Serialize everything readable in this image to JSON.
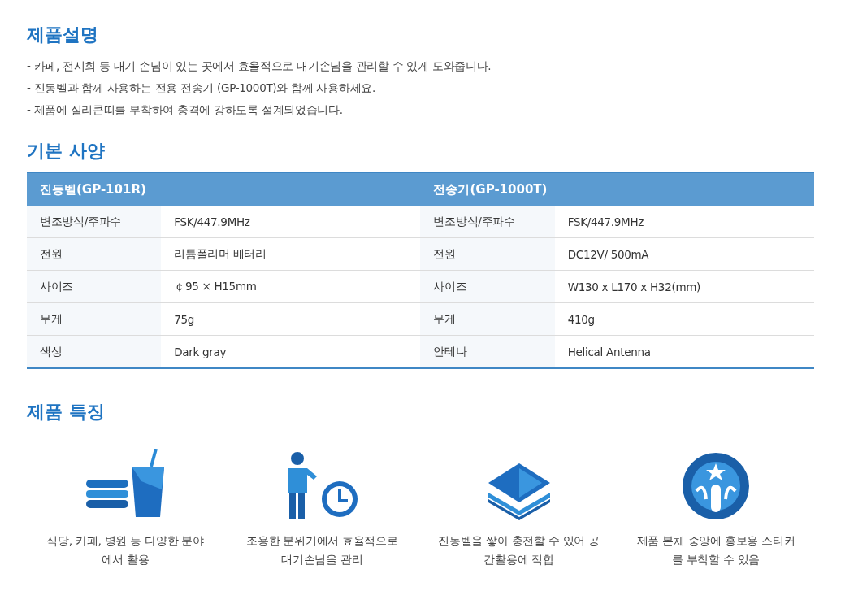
{
  "description": {
    "title": "제품설명",
    "lines": [
      "- 카페, 전시회 등 대기 손님이 있는 곳에서 효율적으로 대기손님을 관리할 수 있게 도와줍니다.",
      "- 진동벨과 함께 사용하는 전용 전송기 (GP-1000T)와 함께 사용하세요.",
      "- 제품에 실리콘띠를 부착하여 충격에 강하도록 설계되었습니다."
    ]
  },
  "specs": {
    "title": "기본 사양",
    "headers": [
      "진동벨(GP-101R)",
      "전송기(GP-1000T)"
    ],
    "rows": [
      [
        "변조방식/주파수",
        "FSK/447.9MHz",
        "변조방식/주파수",
        "FSK/447.9MHz"
      ],
      [
        "전원",
        "리튬폴리머 배터리",
        "전원",
        "DC12V/ 500mA"
      ],
      [
        "사이즈",
        "￠95 × H15mm",
        "사이즈",
        "W130 x L170 x H32(mm)"
      ],
      [
        "무게",
        "75g",
        "무게",
        "410g"
      ],
      [
        "색상",
        "Dark gray",
        "안테나",
        "Helical Antenna"
      ]
    ]
  },
  "features": {
    "title": "제품 특징",
    "items": [
      {
        "kind": "food",
        "lines": [
          "식당, 카페, 병원 등 다양한 분야",
          "에서 활용"
        ]
      },
      {
        "kind": "person",
        "lines": [
          "조용한 분위기에서 효율적으로",
          "대기손님을 관리"
        ]
      },
      {
        "kind": "stack",
        "lines": [
          "진동벨을 쌓아 충전할 수 있어 공",
          "간활용에 적합"
        ]
      },
      {
        "kind": "emblem",
        "lines": [
          "제품 본체 중앙에 홍보용 스티커",
          "를 부착할 수 있음"
        ]
      }
    ]
  }
}
